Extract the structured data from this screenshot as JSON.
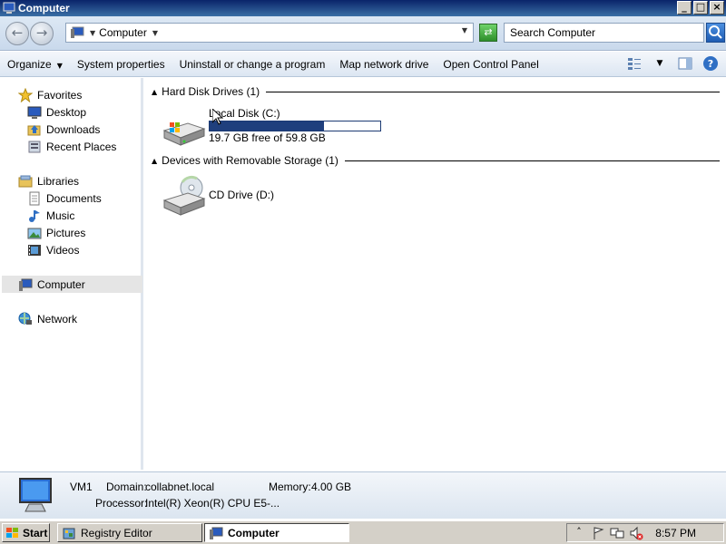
{
  "window": {
    "title": "Computer",
    "minimize": "_",
    "maximize": "□",
    "close": "×"
  },
  "address": {
    "breadcrumb": "Computer",
    "search_placeholder": "Search Computer"
  },
  "commands": {
    "organize": "Organize",
    "system_properties": "System properties",
    "uninstall": "Uninstall or change a program",
    "map_drive": "Map network drive",
    "control_panel": "Open Control Panel"
  },
  "nav": {
    "favorites": "Favorites",
    "desktop": "Desktop",
    "downloads": "Downloads",
    "recent": "Recent Places",
    "libraries": "Libraries",
    "documents": "Documents",
    "music": "Music",
    "pictures": "Pictures",
    "videos": "Videos",
    "computer": "Computer",
    "network": "Network"
  },
  "groups": {
    "hdd": "Hard Disk Drives (1)",
    "removable": "Devices with Removable Storage (1)"
  },
  "drives": {
    "c_label": "Local Disk (C:)",
    "c_space": "19.7 GB free of 59.8 GB",
    "c_used_fraction": 0.67,
    "d_label": "CD Drive (D:)"
  },
  "details": {
    "name": "VM1",
    "domain_label": "Domain:",
    "domain": "collabnet.local",
    "memory_label": "Memory:",
    "memory": "4.00 GB",
    "processor_label": "Processor:",
    "processor": "Intel(R) Xeon(R) CPU E5-..."
  },
  "taskbar": {
    "start": "Start",
    "tasks": [
      "Registry Editor",
      "Computer"
    ],
    "clock": "8:57 PM"
  },
  "colors": {
    "title_bar": "#0a246a",
    "accent": "#1f3f7d"
  }
}
